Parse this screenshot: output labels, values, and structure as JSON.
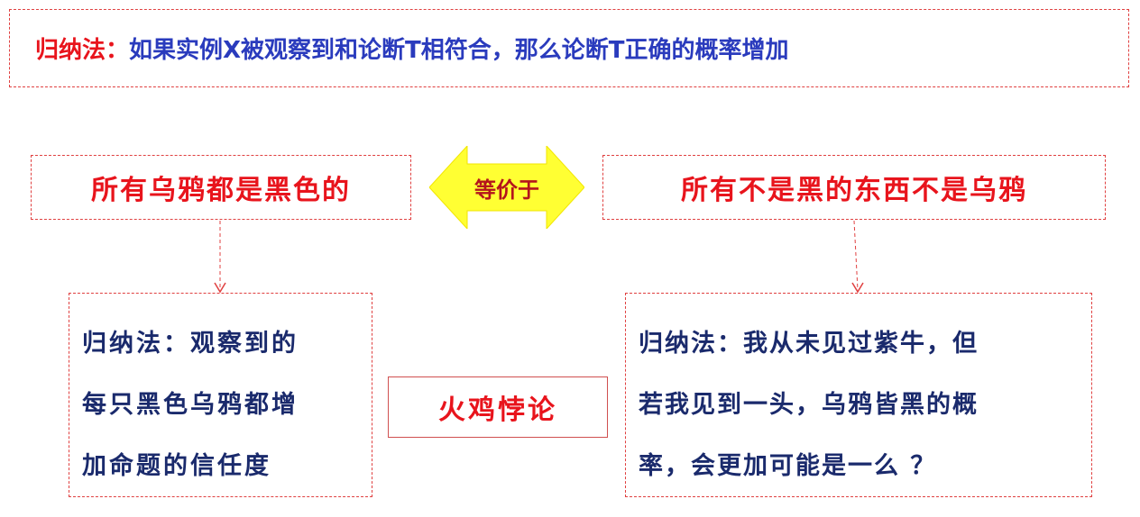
{
  "induction": {
    "term": "归纳法：",
    "definition": "如果实例X被观察到和论断T相符合，那么论断T正确的概率增加"
  },
  "statements": {
    "left": "所有乌鸦都是黑色的",
    "right": "所有不是黑的东西不是乌鸦"
  },
  "equivalence_label": "等价于",
  "explanations": {
    "left_lines": [
      "归纳法：观察到的",
      "每只黑色乌鸦都增",
      "加命题的信任度"
    ],
    "right_lines": [
      "归纳法：我从未见过紫牛，但",
      "若我见到一头，乌鸦皆黑的概",
      "率，会更加可能是一么 ？"
    ]
  },
  "paradox_label": "火鸡悖论",
  "colors": {
    "red": "#e8141c",
    "blue": "#2a3bbd",
    "navy": "#1a2a6c",
    "arrow_fill": "#ffff33",
    "border": "#e04040"
  }
}
